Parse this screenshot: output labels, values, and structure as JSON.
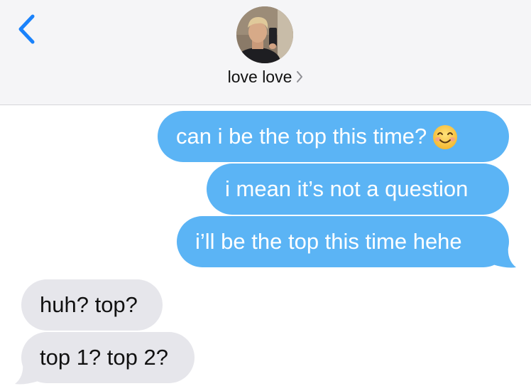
{
  "header": {
    "contact_name": "love love",
    "chevron": ">",
    "back_icon": "chevron-left-icon",
    "accent_color": "#1a82fb"
  },
  "messages": [
    {
      "direction": "sent",
      "text": "can i be the top this time?",
      "emoji": "smiling-face-icon"
    },
    {
      "direction": "sent",
      "text": "i mean it’s not a question"
    },
    {
      "direction": "sent",
      "text": "i’ll be the top this time hehe"
    },
    {
      "direction": "received",
      "text": "huh? top?"
    },
    {
      "direction": "received",
      "text": "top 1? top 2?"
    }
  ],
  "colors": {
    "sent_bubble": "#5bb4f5",
    "received_bubble": "#e6e6eb",
    "header_bg": "#f5f5f7"
  }
}
